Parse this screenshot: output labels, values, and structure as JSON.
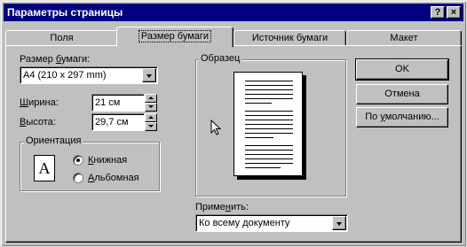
{
  "window": {
    "title": "Параметры страницы"
  },
  "title_buttons": {
    "help": "?",
    "close": "×"
  },
  "tabs": [
    {
      "label": "Поля"
    },
    {
      "label": "Размер бумаги"
    },
    {
      "label": "Источник бумаги"
    },
    {
      "label": "Макет"
    }
  ],
  "paper_size": {
    "label_prefix": "Размер ",
    "label_underlined": "б",
    "label_suffix": "умаги:",
    "value": "A4 (210 x 297 mm)"
  },
  "width": {
    "label_underlined": "Ш",
    "label_suffix": "ирина:",
    "value": "21 см"
  },
  "height": {
    "label_underlined": "В",
    "label_suffix": "ысота:",
    "value": "29,7 см"
  },
  "orientation": {
    "title": "Ориентация",
    "icon_letter": "A",
    "portrait": {
      "underlined": "К",
      "rest": "нижная"
    },
    "landscape": {
      "underlined": "А",
      "rest": "льбомная"
    }
  },
  "preview": {
    "title": "Образец"
  },
  "apply": {
    "label_prefix": "Приме",
    "label_underlined": "н",
    "label_suffix": "ить:",
    "value": "Ко всему документу"
  },
  "buttons": {
    "ok": "OK",
    "cancel": "Отмена",
    "default_prefix": "По ",
    "default_underlined": "у",
    "default_suffix": "молчанию..."
  }
}
